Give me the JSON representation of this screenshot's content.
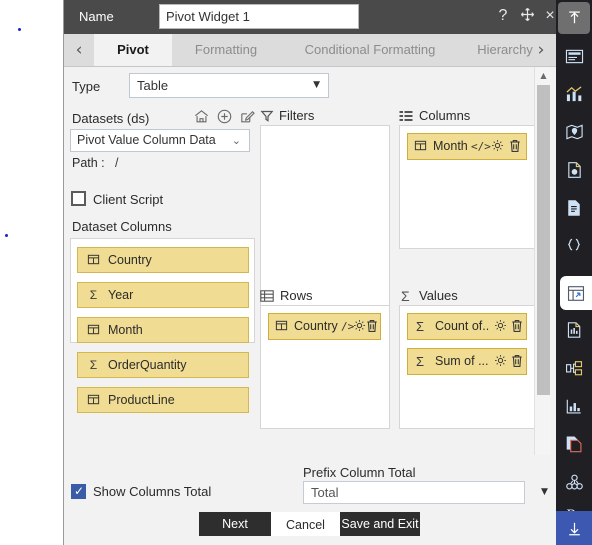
{
  "titlebar": {
    "name_label": "Name",
    "widget_name": "Pivot Widget 1",
    "help_icon": "?",
    "move_icon": "move-icon",
    "close_icon": "×"
  },
  "tabs": {
    "prev_arrow": "‹",
    "next_arrow": "›",
    "items": [
      {
        "label": "Pivot",
        "active": true
      },
      {
        "label": "Formatting",
        "active": false
      },
      {
        "label": "Conditional Formatting",
        "active": false
      },
      {
        "label": "Hierarchy",
        "active": false
      }
    ]
  },
  "form": {
    "type_label": "Type",
    "type_value": "Table",
    "datasets_label": "Datasets (ds)",
    "dataset_value": "Pivot Value Column Data",
    "path_label": "Path :",
    "path_value": "/",
    "client_script_label": "Client Script",
    "client_script_checked": false,
    "dataset_columns_label": "Dataset Columns",
    "dataset_columns": [
      {
        "label": "Country",
        "icon": "table-icon"
      },
      {
        "label": "Year",
        "icon": "sigma-icon"
      },
      {
        "label": "Month",
        "icon": "table-icon"
      },
      {
        "label": "OrderQuantity",
        "icon": "sigma-icon"
      },
      {
        "label": "ProductLine",
        "icon": "table-icon"
      }
    ]
  },
  "panels": {
    "filters": {
      "title": "Filters",
      "icon": "funnel-icon",
      "items": []
    },
    "columns": {
      "title": "Columns",
      "icon": "columns-icon",
      "items": [
        {
          "label": "Month",
          "icon": "table-icon",
          "code_badge": "</>",
          "gear": "gear-icon",
          "trash": "trash-icon"
        }
      ]
    },
    "rows": {
      "title": "Rows",
      "icon": "rows-icon",
      "items": [
        {
          "label": "Country",
          "icon": "table-icon",
          "code_badge": "/>",
          "gear": "gear-icon",
          "trash": "trash-icon"
        }
      ]
    },
    "values": {
      "title": "Values",
      "icon": "sigma-icon",
      "items": [
        {
          "label": "Count of..",
          "icon": "sigma-icon",
          "code_badge": "",
          "gear": "gear-icon",
          "trash": "trash-icon"
        },
        {
          "label": "Sum of ...",
          "icon": "sigma-icon",
          "code_badge": "",
          "gear": "gear-icon",
          "trash": "trash-icon"
        }
      ]
    }
  },
  "bottom": {
    "show_columns_total_label": "Show Columns Total",
    "show_columns_total_checked": true,
    "prefix_column_total_label": "Prefix Column Total",
    "prefix_column_total_value": "Total",
    "buttons": {
      "next": "Next",
      "cancel": "Cancel",
      "save_and_exit": "Save and Exit"
    }
  },
  "rail": {
    "items": [
      {
        "name": "upload-icon",
        "state": "selected-grey"
      },
      {
        "name": "form-widget-icon",
        "state": "normal"
      },
      {
        "name": "chart-icon",
        "state": "normal"
      },
      {
        "name": "map-icon",
        "state": "normal"
      },
      {
        "name": "document-refresh-icon",
        "state": "normal"
      },
      {
        "name": "document-icon",
        "state": "normal"
      },
      {
        "name": "code-braces-icon",
        "state": "normal"
      },
      {
        "name": "image-icon",
        "state": "normal"
      },
      {
        "name": "pivot-table-icon",
        "state": "selected-white"
      },
      {
        "name": "report-icon",
        "state": "normal"
      },
      {
        "name": "tree-icon",
        "state": "normal"
      },
      {
        "name": "bar-chart-icon",
        "state": "normal"
      },
      {
        "name": "copy-icon",
        "state": "normal"
      },
      {
        "name": "cluster-icon",
        "state": "normal"
      },
      {
        "name": "rx-icon",
        "state": "normal"
      },
      {
        "name": "download-icon",
        "state": "selected-blue"
      }
    ]
  },
  "colors": {
    "titlebar_bg": "#4a4a4a",
    "chip_bg": "#f0dc92",
    "chip_border": "#d2b84f",
    "accent_blue": "#3c58b0",
    "rail_bg": "#1f1f24"
  }
}
